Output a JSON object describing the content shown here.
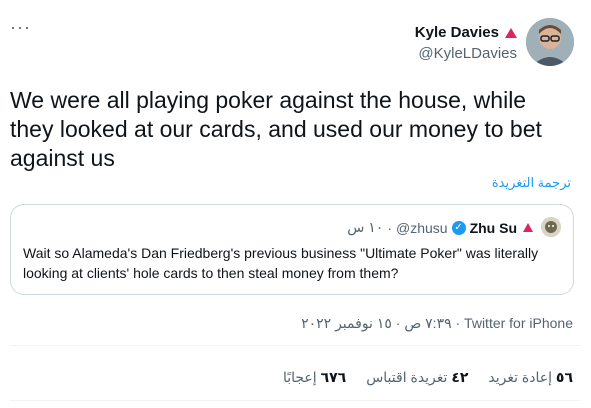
{
  "header": {
    "more_icon": "more-icon",
    "author_name": "Kyle Davies",
    "author_handle": "@KyleLDavies",
    "badge_color": "#e0245e"
  },
  "tweet": {
    "text": "We were all playing poker against the house, while they looked at our cards, and used our money to bet against us",
    "translate_label": "ترجمة التغريدة"
  },
  "quote": {
    "name": "Zhu Su",
    "handle": "@zhusu",
    "time": "١٠ س",
    "separator": "·",
    "verified_mark": "✓",
    "text": "Wait so Alameda's Dan Friedberg's previous business \"Ultimate Poker\" was literally looking at clients' hole cards to then steal money from them?"
  },
  "meta": {
    "timestamp": "٧:٣٩ ص · ١٥ نوفمبر ٢٠٢٢ · Twitter for iPhone"
  },
  "stats": {
    "retweets_count": "٥٦",
    "retweets_label": "إعادة تغريد",
    "quotes_count": "٤٢",
    "quotes_label": "تغريدة اقتباس",
    "likes_count": "٦٧٦",
    "likes_label": "إعجابًا"
  },
  "colors": {
    "link": "#1d9bf0",
    "secondary_text": "#536471",
    "border": "#cfd9de"
  }
}
